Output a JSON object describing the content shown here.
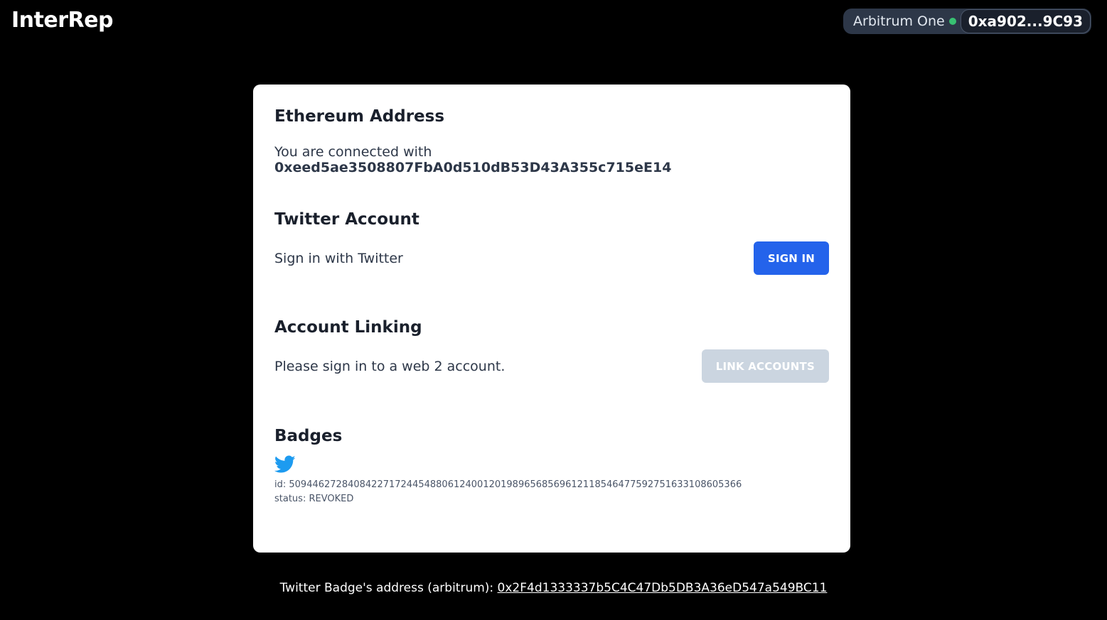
{
  "header": {
    "logo": "InterRep",
    "network": "Arbitrum One",
    "network_status_color": "#38c172",
    "account_short": "0xa902...9C93"
  },
  "ethereum": {
    "title": "Ethereum Address",
    "prefix": "You are connected with",
    "address": "0xeed5ae3508807FbA0d510dB53D43A355c715eE14"
  },
  "twitter": {
    "title": "Twitter Account",
    "text": "Sign in with Twitter",
    "button": "SIGN IN"
  },
  "linking": {
    "title": "Account Linking",
    "text": "Please sign in to a web 2 account.",
    "button": "LINK ACCOUNTS"
  },
  "badges": {
    "title": "Badges",
    "icon": "twitter-icon",
    "id_line": "id: 50944627284084227172445488061240012019896568569612118546477592751633108605366",
    "status_line": "status: REVOKED"
  },
  "footer": {
    "label": "Twitter Badge's address (arbitrum):",
    "address": "0x2F4d1333337b5C4C47Db5DB3A36eD547a549BC11"
  },
  "colors": {
    "background": "#000000",
    "card": "#ffffff",
    "primary_button": "#2463eb",
    "disabled_button": "#cbd5e0",
    "twitter_blue": "#1d9bf0"
  }
}
